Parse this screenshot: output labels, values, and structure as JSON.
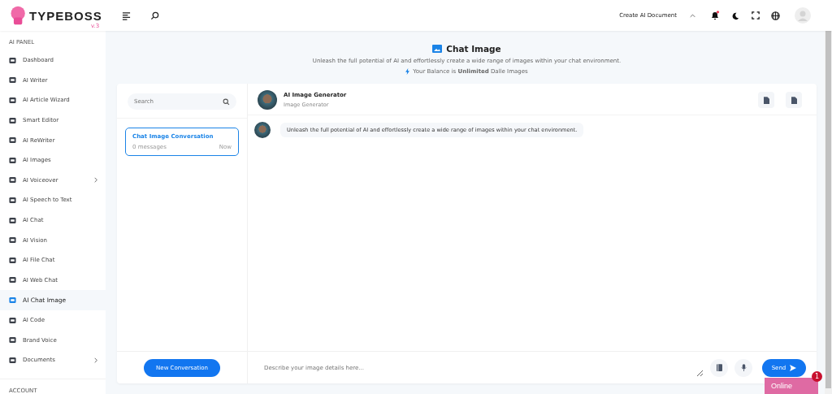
{
  "logo": {
    "name": "TYPEBOSS",
    "version": "v.3"
  },
  "header": {
    "create_label": "Create AI Document",
    "notification": true
  },
  "sidebar": {
    "section": "AI PANEL",
    "items": [
      {
        "label": "Dashboard",
        "selected": false,
        "submenu": false
      },
      {
        "label": "AI Writer",
        "selected": false,
        "submenu": false
      },
      {
        "label": "AI Article Wizard",
        "selected": false,
        "submenu": false
      },
      {
        "label": "Smart Editor",
        "selected": false,
        "submenu": false
      },
      {
        "label": "AI ReWriter",
        "selected": false,
        "submenu": false
      },
      {
        "label": "AI Images",
        "selected": false,
        "submenu": false
      },
      {
        "label": "AI Voiceover",
        "selected": false,
        "submenu": true
      },
      {
        "label": "AI Speech to Text",
        "selected": false,
        "submenu": false
      },
      {
        "label": "AI Chat",
        "selected": false,
        "submenu": false
      },
      {
        "label": "AI Vision",
        "selected": false,
        "submenu": false
      },
      {
        "label": "AI File Chat",
        "selected": false,
        "submenu": false
      },
      {
        "label": "AI Web Chat",
        "selected": false,
        "submenu": false
      },
      {
        "label": "AI Chat Image",
        "selected": true,
        "submenu": false
      },
      {
        "label": "AI Code",
        "selected": false,
        "submenu": false
      },
      {
        "label": "Brand Voice",
        "selected": false,
        "submenu": false
      },
      {
        "label": "Documents",
        "selected": false,
        "submenu": true
      }
    ],
    "section_2": "ACCOUNT"
  },
  "page": {
    "title": "Chat Image",
    "subtitle": "Unleash the full potential of AI and effortlessly create a wide range of images within your chat environment.",
    "balance": "Your Balance is **Unlimited** Dalle Images"
  },
  "conversations": {
    "search_placeholder": "Search",
    "items": [
      {
        "title": "Chat Image Conversation",
        "count": "0 messages",
        "time": "Now",
        "selected": true
      }
    ],
    "new_button": "New Conversation"
  },
  "chat": {
    "name": "AI Image Generator",
    "role": "Image Generator",
    "messages": [
      "Unleash the full potential of AI and effortlessly create a wide range of images within your chat environment."
    ],
    "input_placeholder": "Describe your image details here...",
    "send": "Send"
  },
  "online_widget": {
    "label": "Online",
    "badge": "1"
  }
}
